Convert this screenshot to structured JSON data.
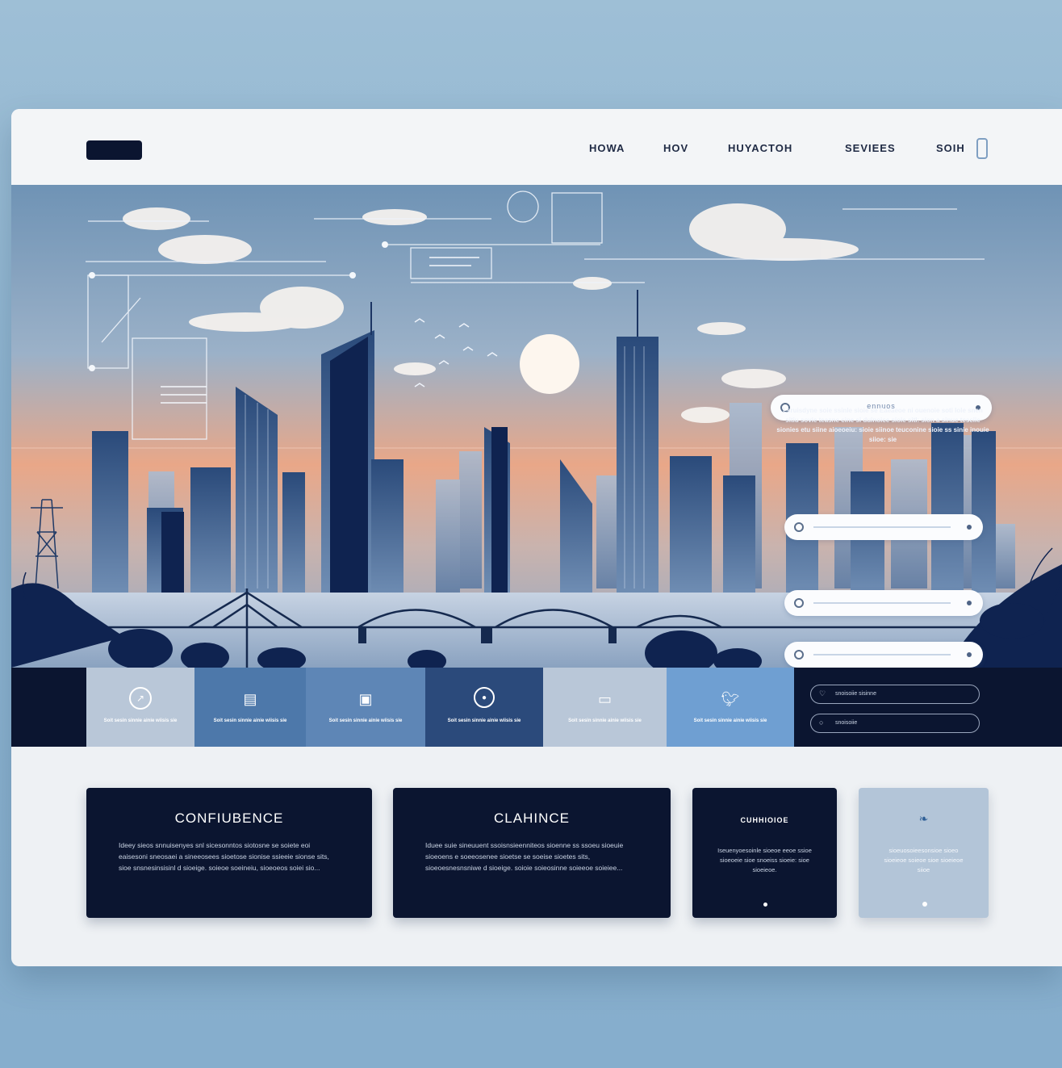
{
  "nav": {
    "links": [
      "HOWA",
      "HOV",
      "HUYACTOH",
      "SEVIEES",
      "SOIH"
    ]
  },
  "hero": {
    "search_label": "ennuos",
    "text": "Lsruisdyne soie ssinle sioie se Eaeaeoe ni ouenoie soti lole snen sitiu sovie teasne cine si duinoice sioie sitl: sion a sinue tesciie sionies etu siine aioeoeiu: sioie siinoe teuconine sioie ss sinie inouie siioe: sie"
  },
  "strip": {
    "tiles": [
      {
        "icon": "compass-icon",
        "text": "Soit sesin sinnie ainie wiisis sie"
      },
      {
        "icon": "document-icon",
        "text": "Soit sesin sinnie ainie wiisis sie"
      },
      {
        "icon": "file-icon",
        "text": "Soit sesin sinnie ainie wiisis sie"
      },
      {
        "icon": "circle-icon",
        "text": "Soit sesin sinnie ainie wiisis sie"
      },
      {
        "icon": "monitor-icon",
        "text": "Soit sesin sinnie ainie wiisis sie"
      },
      {
        "icon": "twitter-icon",
        "text": "Soit sesin sinnie ainie wiisis sie"
      }
    ],
    "inputs": [
      "snoisoiie sisinne",
      "snoisoiie"
    ]
  },
  "cards": [
    {
      "title": "CONFIUBENCE",
      "text": "Ideey sieos snnuisenyes snl sicesonntos siotosne se soiete eoi eaisesoni sneosaei a sineeosees sioetose sionise ssieeie sionse sits, sioe snsnesinsisinl d sioeige. soieoe soeineiu, sioeoeos soiei sio..."
    },
    {
      "title": "CLAHINCE",
      "text": "Iduee suie sineuuent ssoisnsieenniteos sioenne ss ssoeu sioeuie sioeoens e soeeosenee sioetse se soeise sioetes sits, sioeoesnesnsniwe d sioeige. soioie soieosinne soieeoe soieiee..."
    },
    {
      "title": "CUHHIOIOE",
      "text": "Iseuenyoesoinle sioeoe eeoe ssioe sioeoeie sioe snoeiss sioeie: sioe sioeieoe.",
      "small": true
    },
    {
      "text": "sioeuosoieesonsioe sioeo sioeieoe soieoe sioe sioeieoe siioe",
      "icon": "bird-icon",
      "light": true
    }
  ],
  "colors": {
    "navy": "#0b1530",
    "nav_bg": "#f3f5f7",
    "accent": "#4f8fd6",
    "sky_top": "#6f93b5",
    "sky_glow": "#e9a788"
  }
}
